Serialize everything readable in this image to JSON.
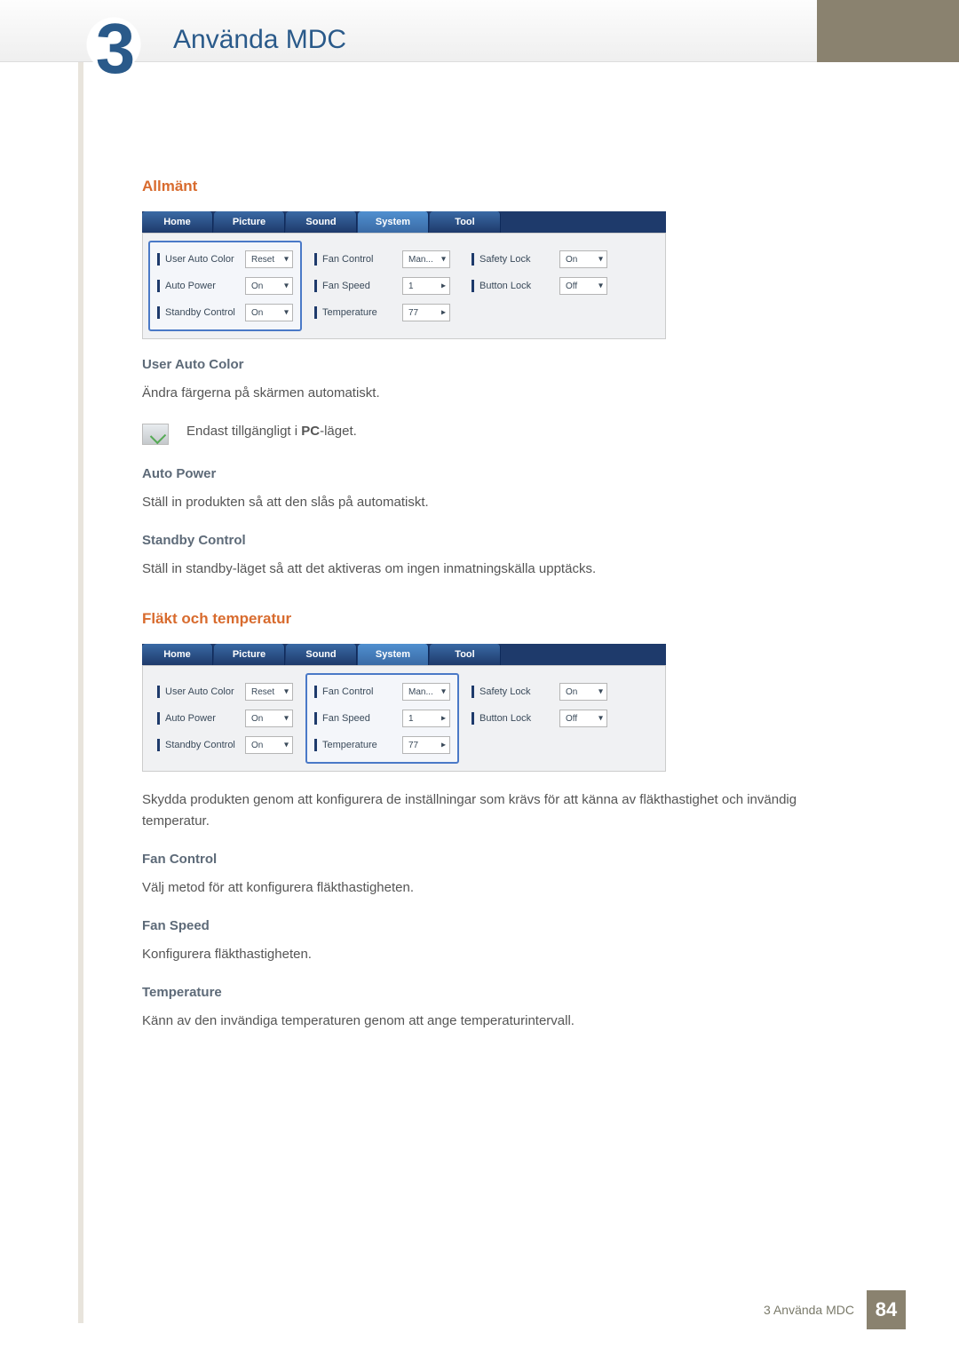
{
  "chapter": {
    "num": "3",
    "title": "Använda MDC"
  },
  "section1": {
    "heading": "Allmänt"
  },
  "section2": {
    "heading": "Fläkt och temperatur"
  },
  "tabs": {
    "home": "Home",
    "picture": "Picture",
    "sound": "Sound",
    "system": "System",
    "tool": "Tool"
  },
  "panel": {
    "col1": [
      {
        "label": "User Auto Color",
        "value": "Reset",
        "ctrl": "caret"
      },
      {
        "label": "Auto Power",
        "value": "On",
        "ctrl": "caret"
      },
      {
        "label": "Standby Control",
        "value": "On",
        "ctrl": "caret"
      }
    ],
    "col2": [
      {
        "label": "Fan Control",
        "value": "Man...",
        "ctrl": "caret"
      },
      {
        "label": "Fan Speed",
        "value": "1",
        "ctrl": "chevron"
      },
      {
        "label": "Temperature",
        "value": "77",
        "ctrl": "chevron"
      }
    ],
    "col3": [
      {
        "label": "Safety Lock",
        "value": "On",
        "ctrl": "caret"
      },
      {
        "label": "Button Lock",
        "value": "Off",
        "ctrl": "caret"
      }
    ]
  },
  "defs": {
    "uac": {
      "heading": "User Auto Color",
      "text": "Ändra färgerna på skärmen automatiskt."
    },
    "note": {
      "pre": "Endast tillgängligt i ",
      "bold": "PC",
      "post": "-läget."
    },
    "ap": {
      "heading": "Auto Power",
      "text": "Ställ in produkten så att den slås på automatiskt."
    },
    "sc": {
      "heading": "Standby Control",
      "text": "Ställ in standby-läget så att det aktiveras om ingen inmatningskälla upptäcks."
    }
  },
  "defs2": {
    "intro": "Skydda produkten genom att konfigurera de inställningar som krävs för att känna av fläkthastighet och invändig temperatur.",
    "fc": {
      "heading": "Fan Control",
      "text": "Välj metod för att konfigurera fläkthastigheten."
    },
    "fs": {
      "heading": "Fan Speed",
      "text": "Konfigurera fläkthastigheten."
    },
    "temp": {
      "heading": "Temperature",
      "text": "Känn av den invändiga temperaturen genom att ange temperaturintervall."
    }
  },
  "footer": {
    "text": "3 Använda MDC",
    "page": "84"
  }
}
